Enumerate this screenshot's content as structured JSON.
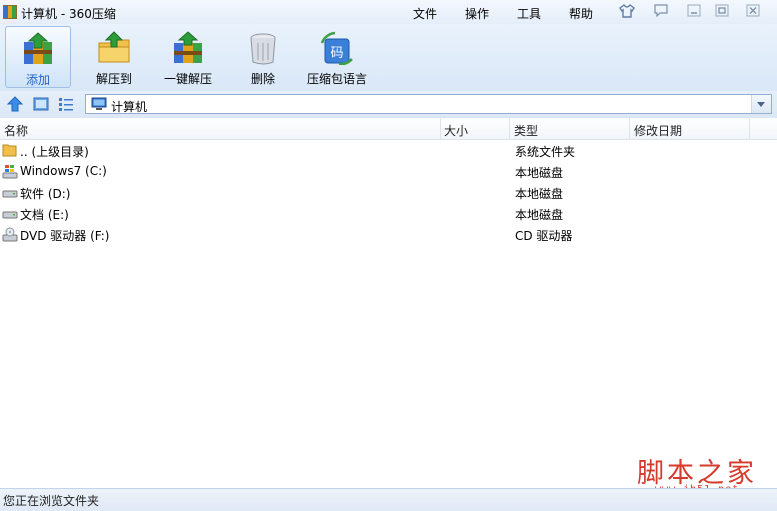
{
  "window": {
    "title": "计算机 - 360压缩"
  },
  "menu": {
    "file": "文件",
    "operate": "操作",
    "tools": "工具",
    "help": "帮助"
  },
  "toolbar": {
    "add": "添加",
    "extract_to": "解压到",
    "one_click_extract": "一键解压",
    "delete": "删除",
    "archive_language": "压缩包语言",
    "archive_language_badge": "码"
  },
  "address": {
    "path": "计算机"
  },
  "columns": {
    "name": "名称",
    "size": "大小",
    "type": "类型",
    "modified": "修改日期"
  },
  "rows": [
    {
      "name": ".. (上级目录)",
      "type": "系统文件夹",
      "icon": "folder-up-icon"
    },
    {
      "name": "Windows7 (C:)",
      "type": "本地磁盘",
      "icon": "windows-drive-icon"
    },
    {
      "name": "软件 (D:)",
      "type": "本地磁盘",
      "icon": "hard-drive-icon"
    },
    {
      "name": "文档 (E:)",
      "type": "本地磁盘",
      "icon": "hard-drive-icon"
    },
    {
      "name": "DVD 驱动器 (F:)",
      "type": "CD 驱动器",
      "icon": "dvd-drive-icon"
    }
  ],
  "status": {
    "text": "您正在浏览文件夹"
  },
  "watermark": {
    "text": "脚本之家",
    "url": "www.jb51.net"
  }
}
